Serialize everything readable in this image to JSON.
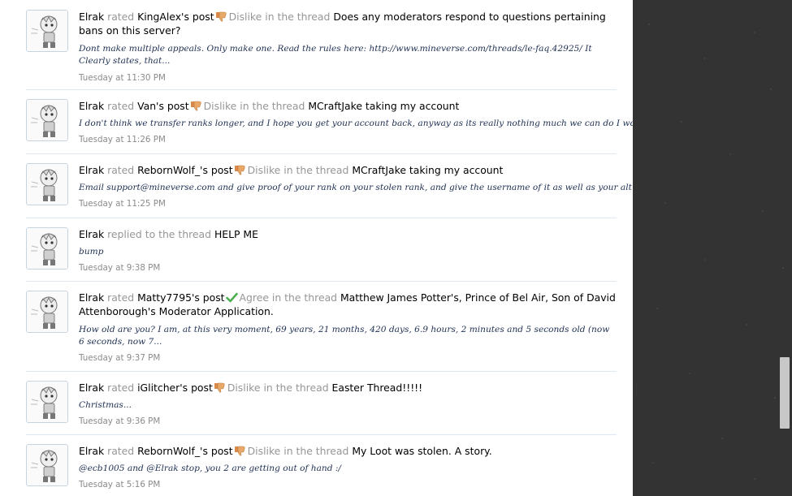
{
  "feed": [
    {
      "user": "Elrak",
      "verb": "rated",
      "target": "KingAlex's post",
      "rating": "Dislike",
      "rating_icon": "thumbs-down-icon",
      "in_text": "in the thread",
      "thread": "Does any moderators respond to questions pertaining bans on this server?",
      "snippet": "Dont make multiple appeals. Only make one. Read the rules here: http://www.mineverse.com/threads/le-faq.42925/ It Clearly states, that...",
      "time": "Tuesday at 11:30 PM"
    },
    {
      "user": "Elrak",
      "verb": "rated",
      "target": "Van's post",
      "rating": "Dislike",
      "rating_icon": "thumbs-down-icon",
      "in_text": "in the thread",
      "thread": "MCraftJake taking my account",
      "snippet": "I don't think we transfer ranks longer, and I hope you get your account back, anyway as its really nothing much we can do I would...",
      "time": "Tuesday at 11:26 PM"
    },
    {
      "user": "Elrak",
      "verb": "rated",
      "target": "RebornWolf_'s post",
      "rating": "Dislike",
      "rating_icon": "thumbs-down-icon",
      "in_text": "in the thread",
      "thread": "MCraftJake taking my account",
      "snippet": "Email support@mineverse.com and give proof of your rank on your stolen rank, and give the username of it as well as your alt.",
      "time": "Tuesday at 11:25 PM"
    },
    {
      "user": "Elrak",
      "verb": "replied to the thread",
      "target": "",
      "rating": "",
      "rating_icon": "",
      "in_text": "",
      "thread": "HELP ME",
      "snippet": "bump",
      "time": "Tuesday at 9:38 PM"
    },
    {
      "user": "Elrak",
      "verb": "rated",
      "target": "Matty7795's post",
      "rating": "Agree",
      "rating_icon": "checkmark-icon",
      "in_text": "in the thread",
      "thread": "Matthew James Potter's, Prince of Bel Air, Son of David Attenborough's Moderator Application.",
      "snippet": "How old are you? I am, at this very moment, 69 years, 21 months, 420 days, 6.9 hours, 2 minutes and 5 seconds old (now 6 seconds, now 7...",
      "time": "Tuesday at 9:37 PM"
    },
    {
      "user": "Elrak",
      "verb": "rated",
      "target": "iGlitcher's post",
      "rating": "Dislike",
      "rating_icon": "thumbs-down-icon",
      "in_text": "in the thread",
      "thread": "Easter Thread!!!!!",
      "snippet": "Christmas...",
      "time": "Tuesday at 9:36 PM"
    },
    {
      "user": "Elrak",
      "verb": "rated",
      "target": "RebornWolf_'s post",
      "rating": "Dislike",
      "rating_icon": "thumbs-down-icon",
      "in_text": "in the thread",
      "thread": "My Loot was stolen. A story.",
      "snippet": "@ecb1005 and @Elrak stop, you 2 are getting out of hand :/",
      "time": "Tuesday at 5:16 PM"
    }
  ],
  "colors": {
    "sidebar_bg": "#333333",
    "divider": "#dfe8f0",
    "muted_text": "#969696",
    "snippet_text": "#223355",
    "dislike_icon": "#e0a060",
    "agree_icon": "#4caf50"
  }
}
